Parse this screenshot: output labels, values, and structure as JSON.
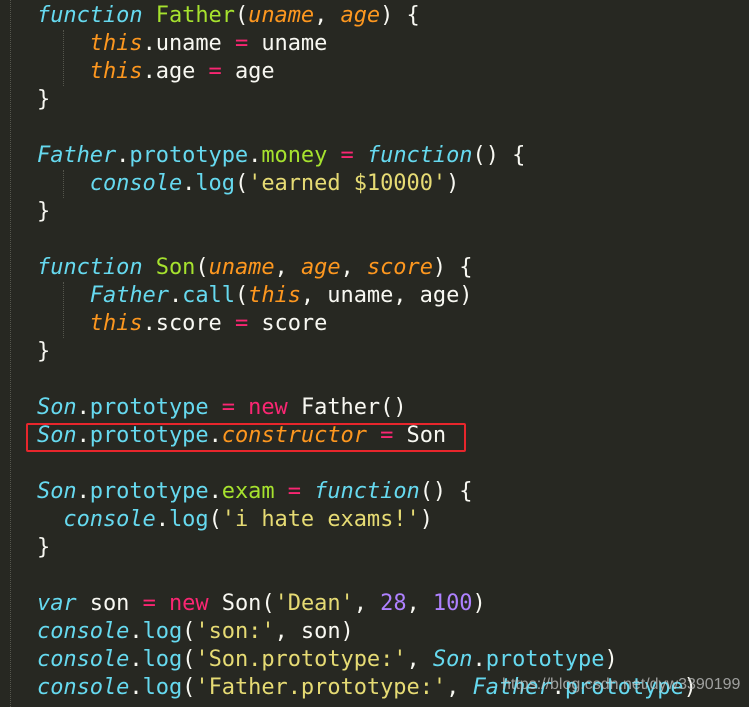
{
  "editor": {
    "theme_colors": {
      "background": "#272822",
      "keyword": "#66d9ef",
      "function_name": "#a6e22e",
      "parameter": "#fd971f",
      "operator": "#f92672",
      "string": "#e6db74",
      "number": "#ae81ff",
      "text": "#f8f8f2",
      "highlight_box": "#e8262c"
    },
    "highlighted_line": 15,
    "lines": [
      [
        [
          "k",
          "function"
        ],
        [
          "t",
          " "
        ],
        [
          "fn",
          "Father"
        ],
        [
          "t",
          "("
        ],
        [
          "p",
          "uname"
        ],
        [
          "t",
          ", "
        ],
        [
          "p",
          "age"
        ],
        [
          "t",
          ") {"
        ]
      ],
      [
        [
          "t",
          "    "
        ],
        [
          "p",
          "this"
        ],
        [
          "t",
          ".uname "
        ],
        [
          "op",
          "="
        ],
        [
          "t",
          " uname"
        ]
      ],
      [
        [
          "t",
          "    "
        ],
        [
          "p",
          "this"
        ],
        [
          "t",
          ".age "
        ],
        [
          "op",
          "="
        ],
        [
          "t",
          " age"
        ]
      ],
      [
        [
          "t",
          "}"
        ]
      ],
      [],
      [
        [
          "c",
          "Father"
        ],
        [
          "t",
          "."
        ],
        [
          "m",
          "prototype"
        ],
        [
          "t",
          "."
        ],
        [
          "fn",
          "money"
        ],
        [
          "t",
          " "
        ],
        [
          "op",
          "="
        ],
        [
          "t",
          " "
        ],
        [
          "k",
          "function"
        ],
        [
          "t",
          "() {"
        ]
      ],
      [
        [
          "t",
          "    "
        ],
        [
          "c",
          "console"
        ],
        [
          "t",
          "."
        ],
        [
          "m",
          "log"
        ],
        [
          "t",
          "("
        ],
        [
          "s",
          "'earned $10000'"
        ],
        [
          "t",
          ")"
        ]
      ],
      [
        [
          "t",
          "}"
        ]
      ],
      [],
      [
        [
          "k",
          "function"
        ],
        [
          "t",
          " "
        ],
        [
          "fn",
          "Son"
        ],
        [
          "t",
          "("
        ],
        [
          "p",
          "uname"
        ],
        [
          "t",
          ", "
        ],
        [
          "p",
          "age"
        ],
        [
          "t",
          ", "
        ],
        [
          "p",
          "score"
        ],
        [
          "t",
          ") {"
        ]
      ],
      [
        [
          "t",
          "    "
        ],
        [
          "c",
          "Father"
        ],
        [
          "t",
          "."
        ],
        [
          "m",
          "call"
        ],
        [
          "t",
          "("
        ],
        [
          "p",
          "this"
        ],
        [
          "t",
          ", uname, age)"
        ]
      ],
      [
        [
          "t",
          "    "
        ],
        [
          "p",
          "this"
        ],
        [
          "t",
          ".score "
        ],
        [
          "op",
          "="
        ],
        [
          "t",
          " score"
        ]
      ],
      [
        [
          "t",
          "}"
        ]
      ],
      [],
      [
        [
          "c",
          "Son"
        ],
        [
          "t",
          "."
        ],
        [
          "m",
          "prototype"
        ],
        [
          "t",
          " "
        ],
        [
          "op",
          "="
        ],
        [
          "t",
          " "
        ],
        [
          "op",
          "new"
        ],
        [
          "t",
          " Father()"
        ]
      ],
      [
        [
          "c",
          "Son"
        ],
        [
          "t",
          "."
        ],
        [
          "m",
          "prototype"
        ],
        [
          "t",
          "."
        ],
        [
          "p",
          "constructor"
        ],
        [
          "t",
          " "
        ],
        [
          "op",
          "="
        ],
        [
          "t",
          " Son"
        ]
      ],
      [],
      [
        [
          "c",
          "Son"
        ],
        [
          "t",
          "."
        ],
        [
          "m",
          "prototype"
        ],
        [
          "t",
          "."
        ],
        [
          "fn",
          "exam"
        ],
        [
          "t",
          " "
        ],
        [
          "op",
          "="
        ],
        [
          "t",
          " "
        ],
        [
          "k",
          "function"
        ],
        [
          "t",
          "() {"
        ]
      ],
      [
        [
          "t",
          "  "
        ],
        [
          "c",
          "console"
        ],
        [
          "t",
          "."
        ],
        [
          "m",
          "log"
        ],
        [
          "t",
          "("
        ],
        [
          "s",
          "'i hate exams!'"
        ],
        [
          "t",
          ")"
        ]
      ],
      [
        [
          "t",
          "}"
        ]
      ],
      [],
      [
        [
          "k",
          "var"
        ],
        [
          "t",
          " son "
        ],
        [
          "op",
          "="
        ],
        [
          "t",
          " "
        ],
        [
          "op",
          "new"
        ],
        [
          "t",
          " Son("
        ],
        [
          "s",
          "'Dean'"
        ],
        [
          "t",
          ", "
        ],
        [
          "n",
          "28"
        ],
        [
          "t",
          ", "
        ],
        [
          "n",
          "100"
        ],
        [
          "t",
          ")"
        ]
      ],
      [
        [
          "c",
          "console"
        ],
        [
          "t",
          "."
        ],
        [
          "m",
          "log"
        ],
        [
          "t",
          "("
        ],
        [
          "s",
          "'son:'"
        ],
        [
          "t",
          ", son)"
        ]
      ],
      [
        [
          "c",
          "console"
        ],
        [
          "t",
          "."
        ],
        [
          "m",
          "log"
        ],
        [
          "t",
          "("
        ],
        [
          "s",
          "'Son.prototype:'"
        ],
        [
          "t",
          ", "
        ],
        [
          "c",
          "Son"
        ],
        [
          "t",
          "."
        ],
        [
          "m",
          "prototype"
        ],
        [
          "t",
          ")"
        ]
      ],
      [
        [
          "c",
          "console"
        ],
        [
          "t",
          "."
        ],
        [
          "m",
          "log"
        ],
        [
          "t",
          "("
        ],
        [
          "s",
          "'Father.prototype:'"
        ],
        [
          "t",
          ", "
        ],
        [
          "c",
          "Father"
        ],
        [
          "t",
          "."
        ],
        [
          "m",
          "prototype"
        ],
        [
          "t",
          ")"
        ]
      ]
    ]
  },
  "watermark": "https://blog.csdn.net/dyw3390199"
}
